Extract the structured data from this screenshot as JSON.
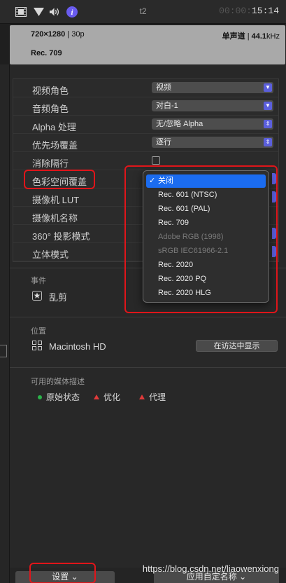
{
  "topbar": {
    "title": "t2",
    "time_dim": "00:00:",
    "time_bright": "15:14",
    "icons": [
      "film-icon",
      "filter-icon",
      "speaker-icon",
      "info-icon"
    ]
  },
  "info": {
    "resolution": "720×1280",
    "framerate": "30p",
    "audio_channels": "单声道",
    "sample_rate_value": "44.1",
    "sample_rate_unit": "kHz",
    "color_space": "Rec. 709"
  },
  "properties": [
    {
      "label": "视频角色",
      "value": "视频",
      "control": "select"
    },
    {
      "label": "音频角色",
      "value": "对白-1",
      "control": "select"
    },
    {
      "label": "Alpha 处理",
      "value": "无/忽略 Alpha",
      "control": "select"
    },
    {
      "label": "优先场覆盖",
      "value": "逐行",
      "control": "select"
    },
    {
      "label": "消除隔行",
      "value": "",
      "control": "checkbox"
    },
    {
      "label": "色彩空间覆盖",
      "value": "",
      "control": "stub"
    },
    {
      "label": "摄像机 LUT",
      "value": "",
      "control": "stub"
    },
    {
      "label": "摄像机名称",
      "value": "",
      "control": "none"
    },
    {
      "label": "360° 投影模式",
      "value": "",
      "control": "stub"
    },
    {
      "label": "立体模式",
      "value": "",
      "control": "stub"
    }
  ],
  "dropdown": {
    "items": [
      {
        "label": "关闭",
        "selected": true,
        "disabled": false
      },
      {
        "label": "Rec. 601 (NTSC)",
        "selected": false,
        "disabled": false
      },
      {
        "label": "Rec. 601 (PAL)",
        "selected": false,
        "disabled": false
      },
      {
        "label": "Rec. 709",
        "selected": false,
        "disabled": false
      },
      {
        "label": "Adobe RGB (1998)",
        "selected": false,
        "disabled": true
      },
      {
        "label": "sRGB IEC61966-2.1",
        "selected": false,
        "disabled": true
      },
      {
        "label": "Rec. 2020",
        "selected": false,
        "disabled": false
      },
      {
        "label": "Rec. 2020 PQ",
        "selected": false,
        "disabled": false
      },
      {
        "label": "Rec. 2020 HLG",
        "selected": false,
        "disabled": false
      }
    ],
    "check_glyph": "✓"
  },
  "event": {
    "title": "事件",
    "name": "乱剪"
  },
  "location": {
    "title": "位置",
    "volume": "Macintosh HD",
    "reveal_button": "在访达中显示"
  },
  "media": {
    "title": "可用的媒体描述",
    "items": [
      {
        "label": "原始状态",
        "kind": "dot",
        "color": "#2ab34a"
      },
      {
        "label": "优化",
        "kind": "triangle",
        "color": "#e03a3a"
      },
      {
        "label": "代理",
        "kind": "triangle",
        "color": "#e03a3a"
      }
    ]
  },
  "bottom": {
    "settings_button": "设置",
    "apply_names_button": "应用自定名称",
    "watermark": "https://blog.csdn.net/liaowenxiong"
  },
  "colors": {
    "accent": "#5b5fdc",
    "menu_highlight": "#1b6cf0",
    "annotation_red": "#e0151a"
  }
}
